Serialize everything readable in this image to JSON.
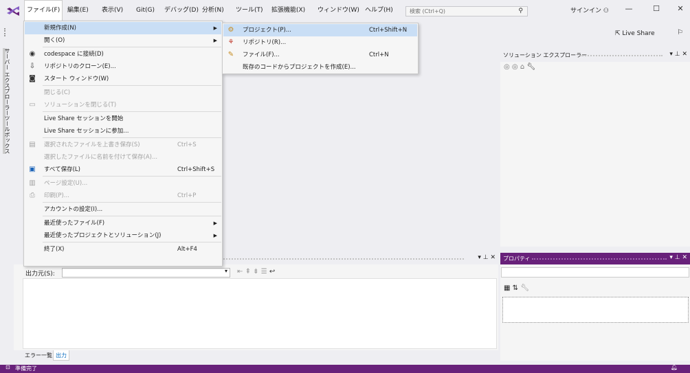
{
  "menubar": {
    "items": [
      {
        "label": "ファイル(F)"
      },
      {
        "label": "編集(E)"
      },
      {
        "label": "表示(V)"
      },
      {
        "label": "Git(G)"
      },
      {
        "label": "デバッグ(D)"
      },
      {
        "label": "分析(N)"
      },
      {
        "label": "ツール(T)"
      },
      {
        "label": "拡張機能(X)"
      },
      {
        "label": "ウィンドウ(W)"
      },
      {
        "label": "ヘルプ(H)"
      }
    ],
    "search_placeholder": "検索 (Ctrl+Q)",
    "signin_label": "サインイン"
  },
  "toolbar": {
    "liveshare_label": "Live Share"
  },
  "left_tabs": [
    "サーバー エクスプローラー",
    "ツールボックス"
  ],
  "file_menu": {
    "items": [
      {
        "icon": "",
        "label": "新規作成(N)",
        "shortcut": "",
        "submenu": true,
        "disabled": false,
        "hover": true
      },
      {
        "icon": "",
        "label": "開く(O)",
        "shortcut": "",
        "submenu": true,
        "disabled": false
      },
      {
        "icon": "codespace-icon",
        "label": "codespace に接続(D)",
        "shortcut": "",
        "submenu": false,
        "disabled": false
      },
      {
        "icon": "clone-icon",
        "label": "リポジトリのクローン(E)...",
        "shortcut": "",
        "submenu": false,
        "disabled": false
      },
      {
        "icon": "start-window-icon",
        "label": "スタート ウィンドウ(W)",
        "shortcut": "",
        "submenu": false,
        "disabled": false
      },
      {
        "icon": "",
        "label": "閉じる(C)",
        "shortcut": "",
        "submenu": false,
        "disabled": true
      },
      {
        "icon": "close-solution-icon",
        "label": "ソリューションを閉じる(T)",
        "shortcut": "",
        "submenu": false,
        "disabled": true
      },
      {
        "icon": "",
        "label": "Live Share セッションを開始",
        "shortcut": "",
        "submenu": false,
        "disabled": false
      },
      {
        "icon": "",
        "label": "Live Share セッションに参加...",
        "shortcut": "",
        "submenu": false,
        "disabled": false
      },
      {
        "icon": "save-icon",
        "label": "選択されたファイルを上書き保存(S)",
        "shortcut": "Ctrl+S",
        "submenu": false,
        "disabled": true
      },
      {
        "icon": "",
        "label": "選択したファイルに名前を付けて保存(A)...",
        "shortcut": "",
        "submenu": false,
        "disabled": true
      },
      {
        "icon": "save-all-icon",
        "label": "すべて保存(L)",
        "shortcut": "Ctrl+Shift+S",
        "submenu": false,
        "disabled": false
      },
      {
        "icon": "page-setup-icon",
        "label": "ページ設定(U)...",
        "shortcut": "",
        "submenu": false,
        "disabled": true
      },
      {
        "icon": "print-icon",
        "label": "印刷(P)...",
        "shortcut": "Ctrl+P",
        "submenu": false,
        "disabled": true
      },
      {
        "icon": "",
        "label": "アカウントの設定(I)...",
        "shortcut": "",
        "submenu": false,
        "disabled": false
      },
      {
        "icon": "",
        "label": "最近使ったファイル(F)",
        "shortcut": "",
        "submenu": true,
        "disabled": false
      },
      {
        "icon": "",
        "label": "最近使ったプロジェクトとソリューション(J)",
        "shortcut": "",
        "submenu": true,
        "disabled": false
      },
      {
        "icon": "",
        "label": "終了(X)",
        "shortcut": "Alt+F4",
        "submenu": false,
        "disabled": false
      }
    ]
  },
  "new_submenu": {
    "items": [
      {
        "icon": "project-icon",
        "label": "プロジェクト(P)...",
        "shortcut": "Ctrl+Shift+N",
        "hover": true
      },
      {
        "icon": "repository-icon",
        "label": "リポジトリ(R)...",
        "shortcut": ""
      },
      {
        "icon": "file-icon",
        "label": "ファイル(F)...",
        "shortcut": "Ctrl+N"
      },
      {
        "icon": "",
        "label": "既存のコードからプロジェクトを作成(E)...",
        "shortcut": ""
      }
    ]
  },
  "solution_explorer": {
    "title": "ソリューション エクスプローラー"
  },
  "properties": {
    "title": "プロパティ"
  },
  "output": {
    "source_label": "出力元(S):",
    "tabs": [
      {
        "label": "エラー一覧",
        "active": false
      },
      {
        "label": "出力",
        "active": true
      }
    ]
  },
  "statusbar": {
    "text": "準備完了"
  },
  "colors": {
    "accent": "#68217a",
    "hover": "#c9def5",
    "vs_logo": "#68217a"
  }
}
